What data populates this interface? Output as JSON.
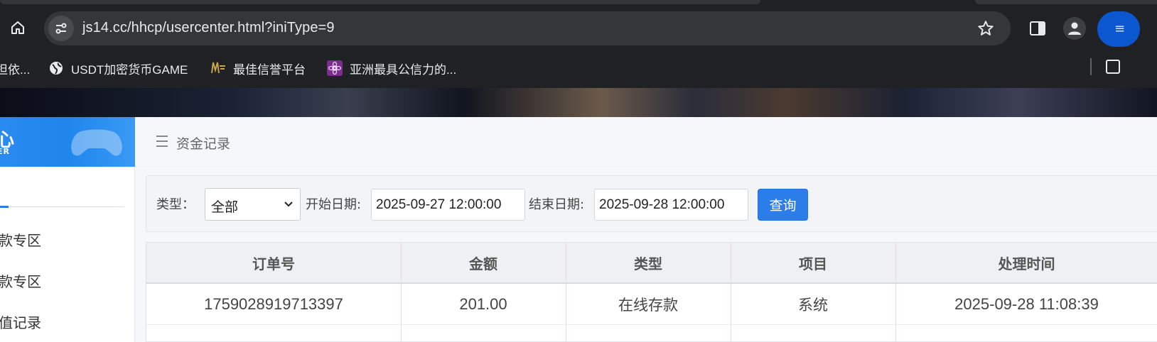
{
  "browser": {
    "url": "js14.cc/hhcp/usercenter.html?iniType=9",
    "bookmarks": [
      {
        "label": "担依...",
        "icon": "none"
      },
      {
        "label": "USDT加密货币GAME",
        "icon": "globe-icon"
      },
      {
        "label": "最佳信誉平台",
        "icon": "site-logo-icon"
      },
      {
        "label": "亚洲最具公信力的...",
        "icon": "purple-flower-icon"
      }
    ],
    "profile_letter": "≡"
  },
  "sidebar": {
    "header_big": "心",
    "header_small": "ER",
    "items": [
      {
        "label": "款专区"
      },
      {
        "label": "款专区"
      },
      {
        "label": "值记录"
      }
    ]
  },
  "page": {
    "title": "资金记录"
  },
  "filter": {
    "type_label": "类型：",
    "type_value": "全部",
    "start_label": "开始日期:",
    "start_value": "2025-09-27 12:00:00",
    "end_label": "结束日期:",
    "end_value": "2025-09-28 12:00:00",
    "query_label": "查询"
  },
  "table": {
    "headers": [
      "订单号",
      "金额",
      "类型",
      "项目",
      "处理时间"
    ],
    "rows": [
      [
        "1759028919713397",
        "201.00",
        "在线存款",
        "系统",
        "2025-09-28 11:08:39"
      ]
    ]
  },
  "colors": {
    "accent": "#2b7de9",
    "chrome_bg": "#202124",
    "omnibox_bg": "#35363a"
  }
}
